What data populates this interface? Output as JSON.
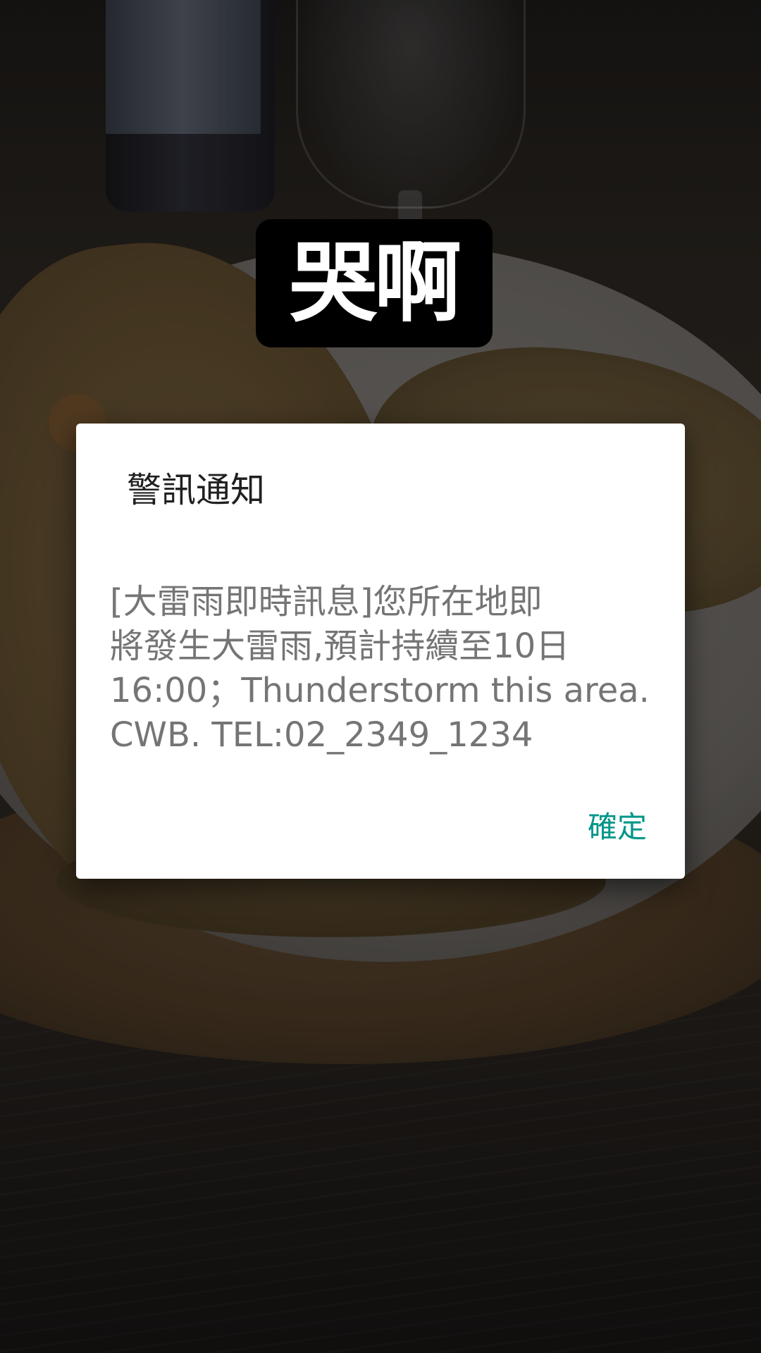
{
  "caption": {
    "text": "哭啊"
  },
  "alert_dialog": {
    "title": "警訊通知",
    "message": "[大雷雨即時訊息]您所在地即\n將發生大雷雨,預計持續至10日\n16:00；Thunderstorm this area.\nCWB. TEL:02_2349_1234",
    "confirm_label": "確定"
  },
  "colors": {
    "accent": "#009688",
    "dialog_background": "#ffffff",
    "title_text": "#202020",
    "message_text": "#757575",
    "caption_background": "#000000",
    "caption_text": "#ffffff"
  }
}
